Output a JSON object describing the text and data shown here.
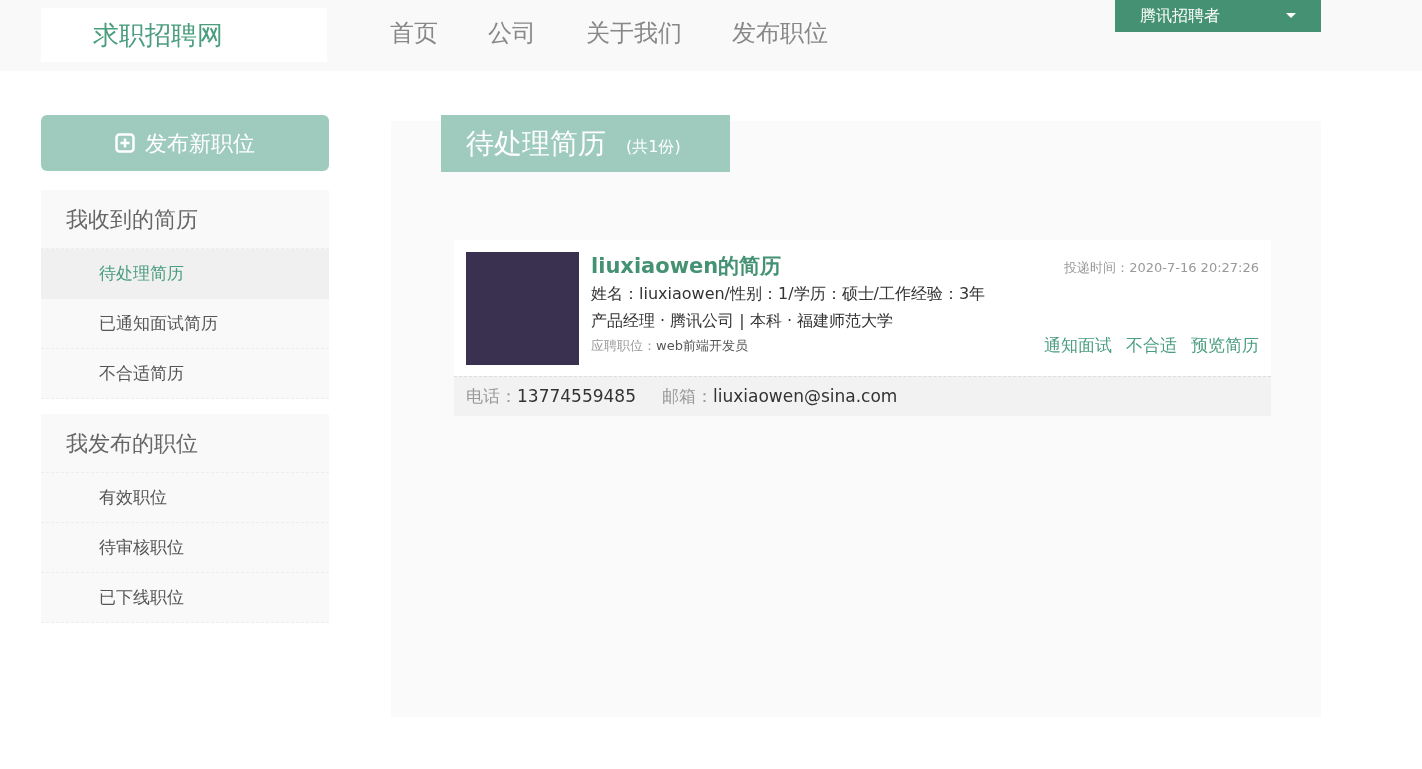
{
  "header": {
    "logo": "求职招聘网",
    "nav": [
      {
        "label": "首页",
        "selected": false
      },
      {
        "label": "公司",
        "selected": false
      },
      {
        "label": "关于我们",
        "selected": false
      },
      {
        "label": "发布职位",
        "selected": false
      }
    ],
    "user_menu": "腾讯招聘者"
  },
  "sidebar": {
    "post_button": "发布新职位",
    "groups": [
      {
        "title": "我收到的简历",
        "items": [
          {
            "label": "待处理简历",
            "selected": true
          },
          {
            "label": "已通知面试简历",
            "selected": false
          },
          {
            "label": "不合适简历",
            "selected": false
          }
        ]
      },
      {
        "title": "我发布的职位",
        "items": [
          {
            "label": "有效职位",
            "selected": false
          },
          {
            "label": "待审核职位",
            "selected": false
          },
          {
            "label": "已下线职位",
            "selected": false
          }
        ]
      }
    ]
  },
  "main": {
    "title": "待处理简历",
    "count": "(共1份)",
    "resumes": [
      {
        "name": "liuxiaowen的简历",
        "info": "姓名：liuxiaowen/性别：1/学历：硕士/工作经验：3年",
        "detail": "产品经理 · 腾讯公司 | 本科 · 福建师范大学",
        "position_label": "应聘职位：",
        "position": "web前端开发员",
        "time": "投递时间：2020-7-16 20:27:26",
        "actions": [
          "通知面试",
          "不合适",
          "预览简历"
        ],
        "phone_label": "电话：",
        "phone": "13774559485",
        "email_label": "邮箱：",
        "email": "liuxiaowen@sina.com"
      }
    ]
  }
}
